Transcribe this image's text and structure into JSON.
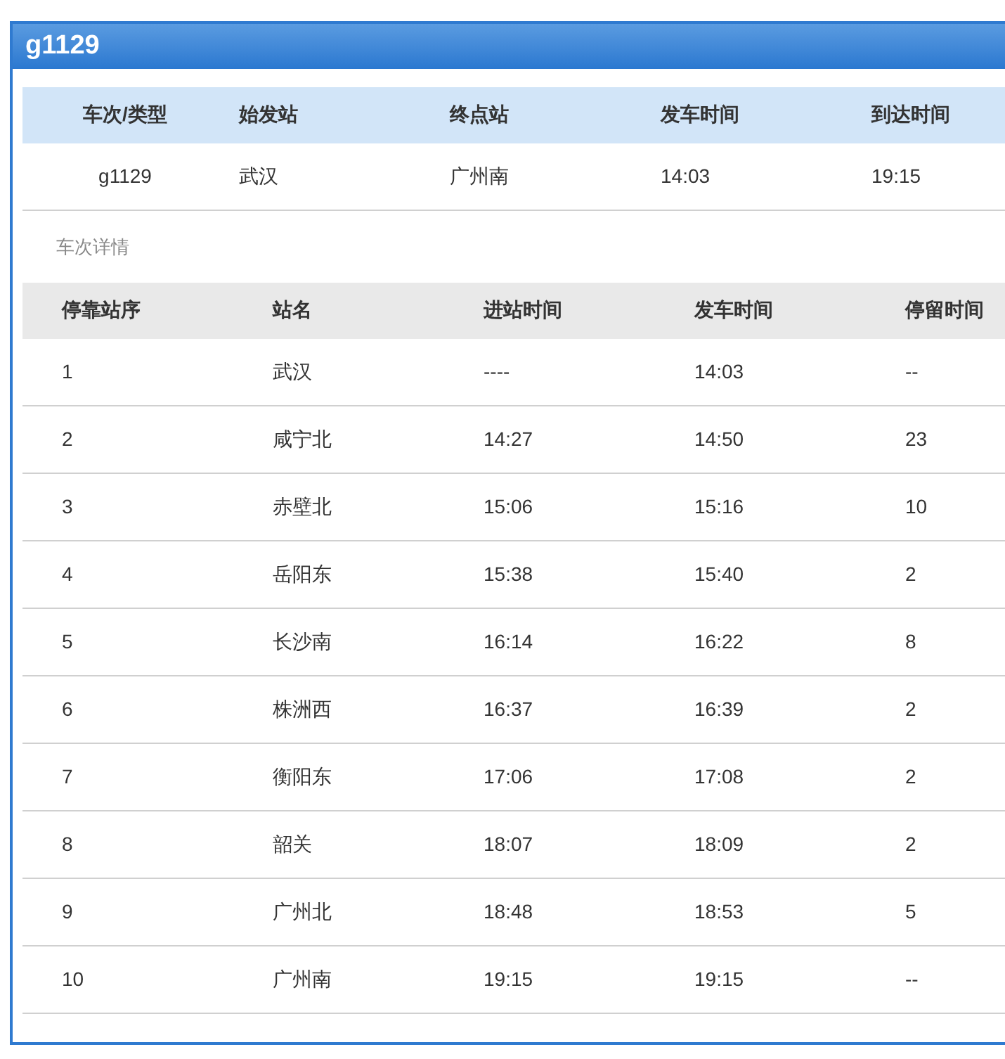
{
  "window": {
    "title": "g1129"
  },
  "summary": {
    "columns": [
      "车次/类型",
      "始发站",
      "终点站",
      "发车时间",
      "到达时间"
    ],
    "rows": [
      [
        "g1129",
        "武汉",
        "广州南",
        "14:03",
        "19:15"
      ]
    ]
  },
  "details_label": "车次详情",
  "stops": {
    "columns": [
      "停靠站序",
      "站名",
      "进站时间",
      "发车时间",
      "停留时间"
    ],
    "rows": [
      [
        "1",
        "武汉",
        "----",
        "14:03",
        "--"
      ],
      [
        "2",
        "咸宁北",
        "14:27",
        "14:50",
        "23"
      ],
      [
        "3",
        "赤壁北",
        "15:06",
        "15:16",
        "10"
      ],
      [
        "4",
        "岳阳东",
        "15:38",
        "15:40",
        "2"
      ],
      [
        "5",
        "长沙南",
        "16:14",
        "16:22",
        "8"
      ],
      [
        "6",
        "株洲西",
        "16:37",
        "16:39",
        "2"
      ],
      [
        "7",
        "衡阳东",
        "17:06",
        "17:08",
        "2"
      ],
      [
        "8",
        "韶关",
        "18:07",
        "18:09",
        "2"
      ],
      [
        "9",
        "广州北",
        "18:48",
        "18:53",
        "5"
      ],
      [
        "10",
        "广州南",
        "19:15",
        "19:15",
        "--"
      ]
    ]
  }
}
